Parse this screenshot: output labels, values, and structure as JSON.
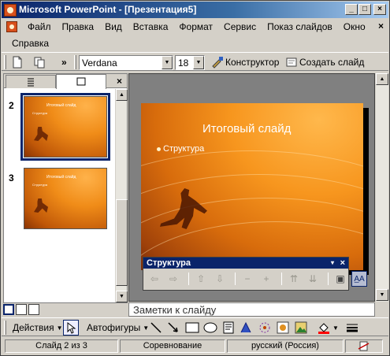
{
  "window": {
    "title": "Microsoft PowerPoint - [Презентация5]",
    "minimize": "_",
    "maximize": "□",
    "close": "×"
  },
  "menu": {
    "row1": [
      "Файл",
      "Правка",
      "Вид",
      "Вставка",
      "Формат",
      "Сервис",
      "Показ слайдов",
      "Окно"
    ],
    "row2": [
      "Справка"
    ]
  },
  "toolbar": {
    "font_name": "Verdana",
    "font_size": "18",
    "design_label": "Конструктор",
    "new_slide_label": "Создать слайд",
    "overflow": "»"
  },
  "left_pane": {
    "close_label": "×",
    "thumbnails": [
      {
        "number": "2",
        "title": "Итоговый слайд",
        "bullet": "Структура",
        "selected": true
      },
      {
        "number": "3",
        "title": "Итоговый слайд",
        "bullet": "Структура",
        "selected": false
      }
    ]
  },
  "slide": {
    "title": "Итоговый слайд",
    "bullet": "Структура"
  },
  "structure_toolbar": {
    "title": "Структура",
    "close": "×",
    "dropdown": "▾",
    "buttons": [
      "⇦",
      "⇨",
      "⇧",
      "⇩",
      "−",
      "+",
      "⇈",
      "⇊",
      "▣",
      "A̲A"
    ]
  },
  "notes": {
    "placeholder": "Заметки к слайду"
  },
  "drawing": {
    "actions_label": "Действия",
    "autoshapes_label": "Автофигуры"
  },
  "status": {
    "slide": "Слайд 2 из 3",
    "design": "Соревнование",
    "language": "русский (Россия)"
  },
  "colors": {
    "titlebar": "#0a246a",
    "slide_orange": "#f7961e",
    "selection": "#0a246a"
  }
}
